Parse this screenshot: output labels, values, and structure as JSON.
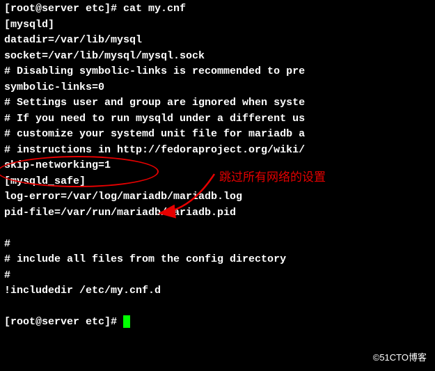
{
  "terminal": {
    "lines": [
      "[root@server etc]# cat my.cnf",
      "[mysqld]",
      "datadir=/var/lib/mysql",
      "socket=/var/lib/mysql/mysql.sock",
      "# Disabling symbolic-links is recommended to pre",
      "symbolic-links=0",
      "# Settings user and group are ignored when syste",
      "# If you need to run mysqld under a different us",
      "# customize your systemd unit file for mariadb a",
      "# instructions in http://fedoraproject.org/wiki/",
      "skip-networking=1",
      "[mysqld_safe]",
      "log-error=/var/log/mariadb/mariadb.log",
      "pid-file=/var/run/mariadb/mariadb.pid",
      "",
      "#",
      "# include all files from the config directory",
      "#",
      "!includedir /etc/my.cnf.d",
      "",
      "[root@server etc]# "
    ]
  },
  "annotation": {
    "text": "跳过所有网络的设置"
  },
  "watermark": "©51CTO博客"
}
